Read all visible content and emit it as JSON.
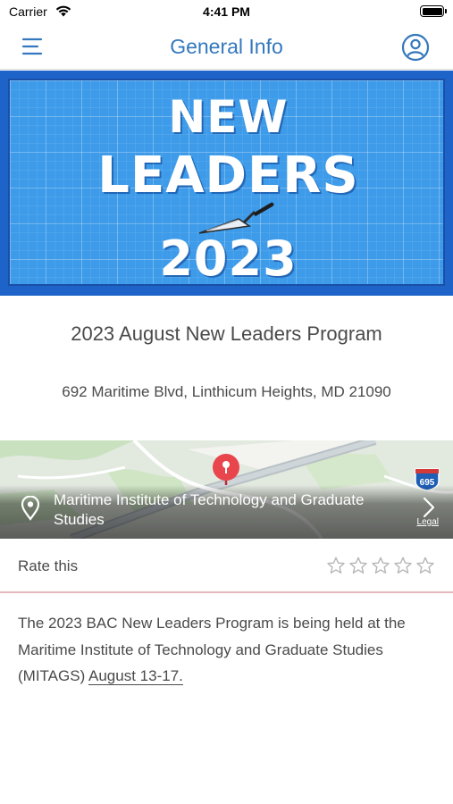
{
  "status_bar": {
    "carrier": "Carrier",
    "time": "4:41 PM",
    "icons": [
      "wifi-icon",
      "battery-icon"
    ]
  },
  "nav": {
    "title": "General Info",
    "left_icon": "menu-icon",
    "right_icon": "profile-icon",
    "accent_color": "#3478bd"
  },
  "hero": {
    "line1": "NEW",
    "line2": "LEADERS",
    "line3": "2023",
    "icon": "trowel-icon",
    "background_color": "#3d9be9"
  },
  "event": {
    "title": "2023 August New Leaders Program",
    "address": "692 Maritime Blvd, Linthicum Heights, MD 21090"
  },
  "map": {
    "location_name": "Maritime Institute of Technology and Graduate Studies",
    "highway_shield": "695",
    "legal": "Legal",
    "pin_color": "#e8454c"
  },
  "rating": {
    "label": "Rate this",
    "max_stars": 5,
    "value": 0
  },
  "description": {
    "text": "The 2023 BAC New Leaders Program is being held at the Maritime Institute of Technology and Graduate Studies (MITAGS) ",
    "date_link": "August 13-17."
  }
}
